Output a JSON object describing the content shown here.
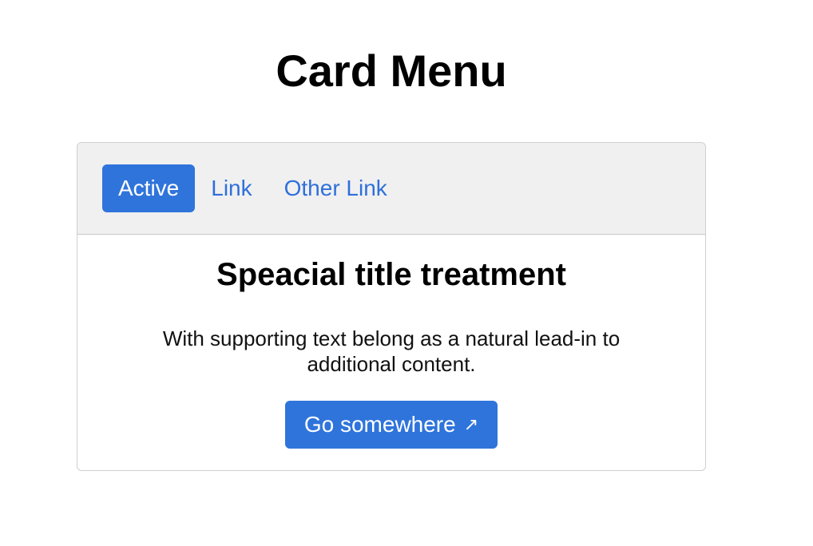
{
  "page": {
    "title": "Card Menu"
  },
  "card": {
    "nav": [
      {
        "label": "Active",
        "active": true
      },
      {
        "label": "Link",
        "active": false
      },
      {
        "label": "Other Link",
        "active": false
      }
    ],
    "title": "Speacial title treatment",
    "text": "With supporting text belong as a natural lead-in to additional content.",
    "button_label": "Go somewhere",
    "button_icon": "↗",
    "button_icon_name": "external-link-arrow-icon"
  },
  "colors": {
    "accent": "#2f74db",
    "link": "#2f6fdb",
    "header_bg": "#f0f0f0",
    "border": "#cfcfcf"
  }
}
